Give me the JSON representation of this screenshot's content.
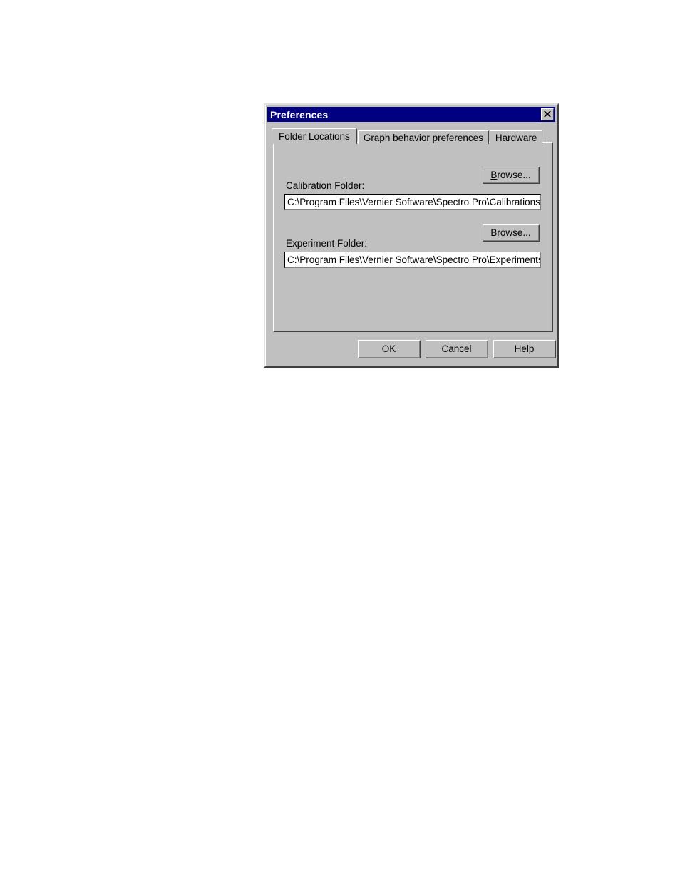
{
  "dialog": {
    "title": "Preferences",
    "close_icon": "close-icon"
  },
  "tabs": [
    {
      "label": "Folder Locations",
      "active": true
    },
    {
      "label": "Graph behavior preferences",
      "active": false
    },
    {
      "label": "Hardware",
      "active": false
    }
  ],
  "folder_locations": {
    "calibration": {
      "label": "Calibration Folder:",
      "browse_label_prefix": "",
      "browse_label_underlined": "B",
      "browse_label_suffix": "rowse...",
      "path": "C:\\Program Files\\Vernier Software\\Spectro Pro\\Calibrations\\"
    },
    "experiment": {
      "label": "Experiment Folder:",
      "browse_label_prefix": "B",
      "browse_label_underlined": "r",
      "browse_label_suffix": "owse...",
      "path": "C:\\Program Files\\Vernier Software\\Spectro Pro\\Experiments\\"
    }
  },
  "buttons": {
    "ok": "OK",
    "cancel": "Cancel",
    "help": "Help"
  },
  "colors": {
    "titlebar": "#000080",
    "face": "#c0c0c0",
    "field_bg": "#ffffff",
    "text": "#000000"
  }
}
